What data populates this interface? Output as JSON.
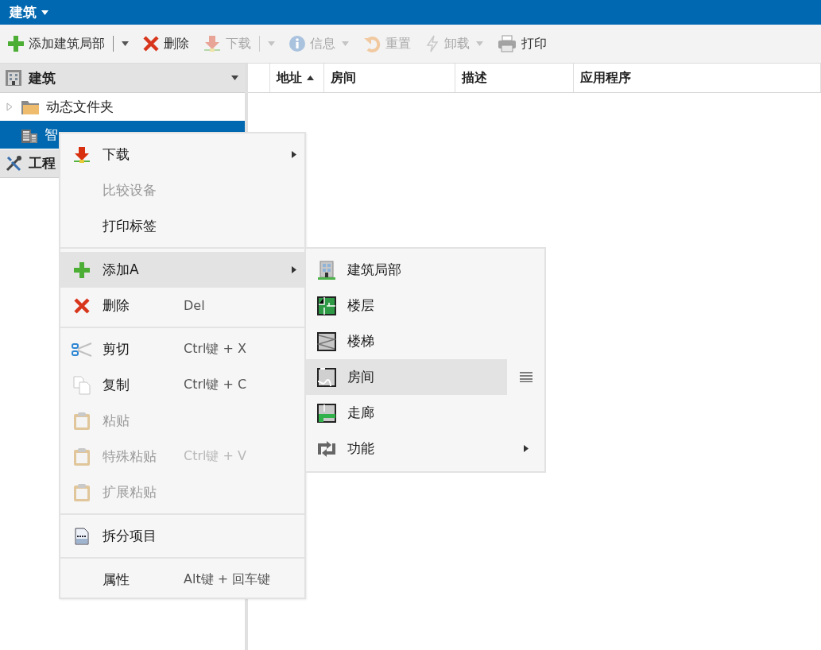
{
  "app_bar": {
    "title": "建筑"
  },
  "toolbar": [
    {
      "label": "添加建筑局部",
      "disabled": false,
      "dropdown": true,
      "split": true
    },
    {
      "label": "删除",
      "disabled": false,
      "dropdown": false,
      "split": false
    },
    {
      "label": "下载",
      "disabled": true,
      "dropdown": true,
      "split": true
    },
    {
      "label": "信息",
      "disabled": true,
      "dropdown": true,
      "split": false
    },
    {
      "label": "重置",
      "disabled": true,
      "dropdown": false,
      "split": false
    },
    {
      "label": "卸载",
      "disabled": true,
      "dropdown": true,
      "split": false
    },
    {
      "label": "打印",
      "disabled": false,
      "dropdown": false,
      "split": false
    }
  ],
  "sidebar": {
    "title": "建筑",
    "tree": [
      {
        "label": "动态文件夹",
        "selected": false,
        "expandable": true
      },
      {
        "label": "智",
        "selected": true,
        "expandable": false
      }
    ],
    "sections": [
      {
        "label": "工程"
      }
    ]
  },
  "table": {
    "columns": [
      {
        "label": "地址",
        "sorted": true
      },
      {
        "label": "房间",
        "sorted": false
      },
      {
        "label": "描述",
        "sorted": false
      },
      {
        "label": "应用程序",
        "sorted": false
      }
    ]
  },
  "context_menu": {
    "groups": [
      {
        "items": [
          {
            "label": "下载",
            "disabled": false,
            "submenu": true,
            "selected": false
          },
          {
            "label": "比较设备",
            "disabled": true,
            "submenu": false,
            "selected": false
          },
          {
            "label": "打印标签",
            "disabled": false,
            "submenu": false,
            "selected": false
          }
        ]
      },
      {
        "items": [
          {
            "label": "添加A",
            "disabled": false,
            "submenu": true,
            "selected": true
          },
          {
            "label": "删除",
            "shortcut": "Del",
            "disabled": false,
            "submenu": false,
            "selected": false
          }
        ]
      },
      {
        "items": [
          {
            "label": "剪切",
            "shortcut": "Ctrl键 + X",
            "disabled": false,
            "submenu": false,
            "selected": false
          },
          {
            "label": "复制",
            "shortcut": "Ctrl键 + C",
            "disabled": false,
            "submenu": false,
            "selected": false
          },
          {
            "label": "粘贴",
            "disabled": true,
            "submenu": false,
            "selected": false
          },
          {
            "label": "特殊粘贴",
            "shortcut": "Ctrl键 + V",
            "disabled": true,
            "submenu": false,
            "selected": false
          },
          {
            "label": "扩展粘贴",
            "disabled": true,
            "submenu": false,
            "selected": false
          }
        ]
      },
      {
        "items": [
          {
            "label": "拆分项目",
            "disabled": false,
            "submenu": false,
            "selected": false
          }
        ]
      },
      {
        "items": [
          {
            "label": "属性",
            "shortcut": "Alt键 + 回车键",
            "disabled": false,
            "submenu": false,
            "selected": false
          }
        ]
      }
    ]
  },
  "submenu": {
    "items": [
      {
        "label": "建筑局部",
        "submenu": false,
        "selected": false
      },
      {
        "label": "楼层",
        "submenu": false,
        "selected": false
      },
      {
        "label": "楼梯",
        "submenu": false,
        "selected": false
      },
      {
        "label": "房间",
        "submenu": false,
        "selected": true
      },
      {
        "label": "走廊",
        "submenu": false,
        "selected": false
      },
      {
        "label": "功能",
        "submenu": true,
        "selected": false
      }
    ]
  }
}
